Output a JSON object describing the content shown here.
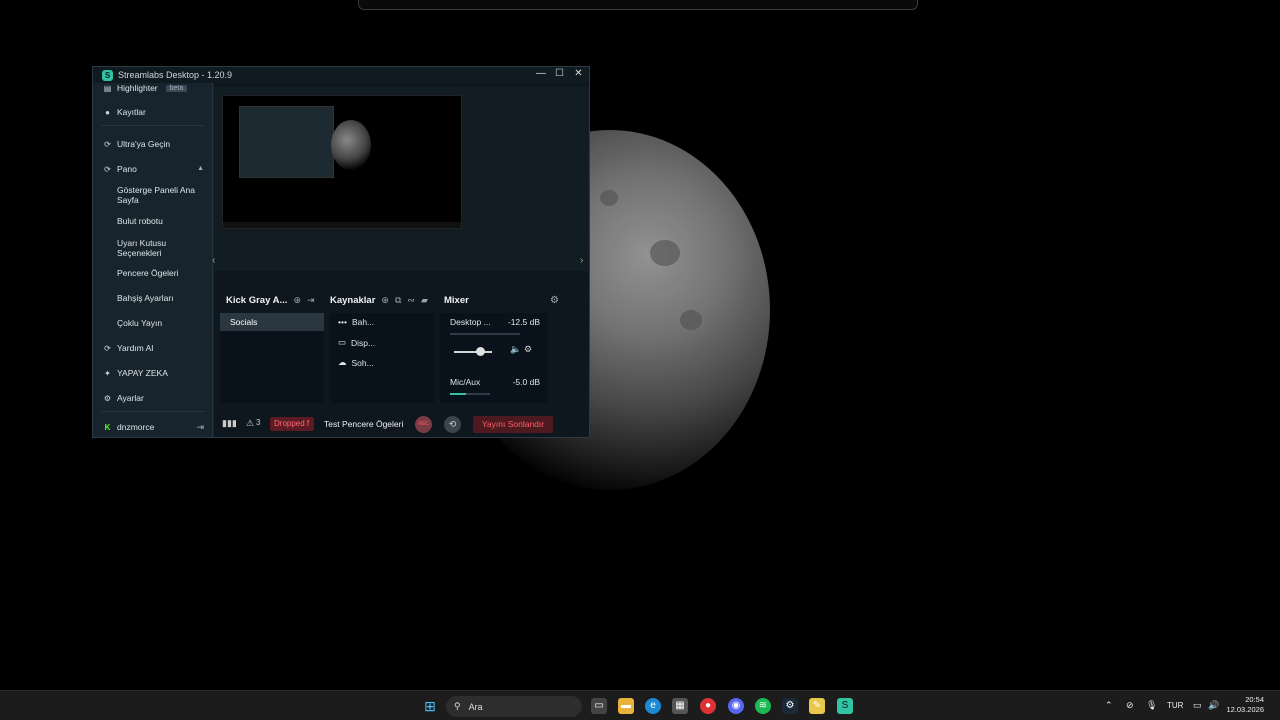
{
  "window": {
    "title": "Streamlabs Desktop - 1.20.9",
    "minimize": "—",
    "maximize": "☐",
    "close": "✕"
  },
  "sidebar": {
    "highlighter": "Highlighter",
    "beta": "beta",
    "kayitlar": "Kayıtlar",
    "ultra": "Ultra'ya Geçin",
    "pano": "Pano",
    "sub": {
      "gosterge": "Gösterge Paneli Ana Sayfa",
      "bulut": "Bulut robotu",
      "uyari": "Uyarı Kutusu Seçenekleri",
      "pencere": "Pencere Ögeleri",
      "bahsis": "Bahşiş Ayarları",
      "coklu": "Çoklu Yayın"
    },
    "yardim": "Yardım Al",
    "yapay": "YAPAY ZEKA",
    "ayarlar": "Ayarlar",
    "user": "dnzmorce"
  },
  "scenes": {
    "title": "Kick Gray A...",
    "items": [
      "Socials"
    ]
  },
  "sources": {
    "title": "Kaynaklar",
    "items": [
      "Bah...",
      "Disp...",
      "Soh..."
    ]
  },
  "mixer": {
    "title": "Mixer",
    "channels": [
      {
        "name": "Desktop ...",
        "level": "-12.5 dB"
      },
      {
        "name": "Mic/Aux",
        "level": "-5.0 dB"
      }
    ]
  },
  "status": {
    "warnings": "3",
    "dropped": "Dropped f",
    "scene_name": "Test Pencere Ögeleri",
    "rec": "REC",
    "end_stream": "Yayını Sonlandır"
  },
  "taskbar": {
    "search": "Ara",
    "lang": "TUR",
    "time": "20:54",
    "date": "12.03.2026"
  },
  "colors": {
    "accent": "#31c3a2",
    "danger": "#ff5d6a",
    "panel": "#17242d"
  }
}
